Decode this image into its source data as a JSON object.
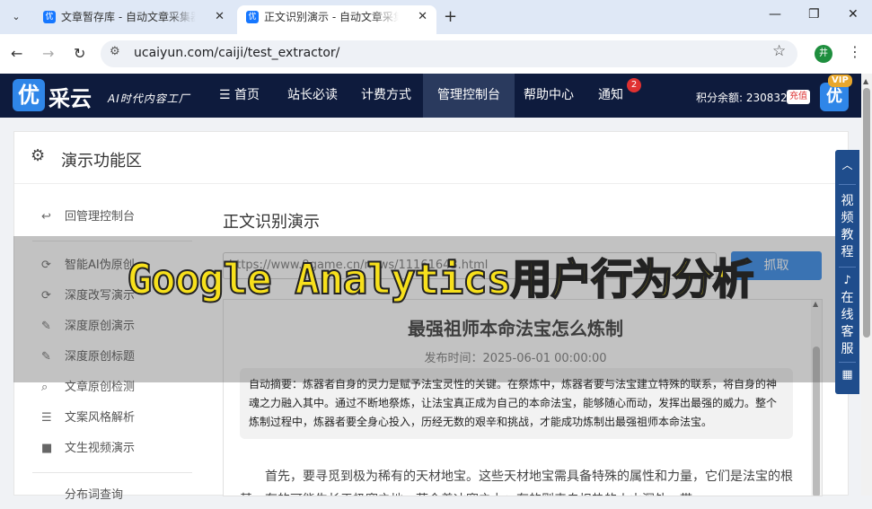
{
  "browser": {
    "tabs": [
      {
        "title": "文章暂存库 - 自动文章采集器 - 优采云",
        "active": false
      },
      {
        "title": "正文识别演示 - 自动文章采集器 - 优采云",
        "active": true
      }
    ],
    "new_tab": "+",
    "url": "ucaiyun.com/caiji/test_extractor/",
    "profile_initial": "井"
  },
  "site": {
    "logo_char": "优",
    "logo_text": "采云",
    "slogan": "AI时代内容工厂",
    "nav": [
      "☰ 首页",
      "站长必读",
      "计费方式",
      "管理控制台",
      "帮助中心",
      "通知"
    ],
    "notify_count": "2",
    "points_text": "积分余额: 2308329",
    "recharge": "充值",
    "vip": "VIP",
    "avatar_char": "优"
  },
  "panel": {
    "title": "演示功能区",
    "sidebar": [
      {
        "icon": "↩",
        "label": "回管理控制台"
      },
      {
        "icon": "⟳",
        "label": "智能AI伪原创"
      },
      {
        "icon": "⟳",
        "label": "深度改写演示"
      },
      {
        "icon": "✎",
        "label": "深度原创演示"
      },
      {
        "icon": "✎",
        "label": "深度原创标题"
      },
      {
        "icon": "⌕",
        "label": "文章原创检测"
      },
      {
        "icon": "☰",
        "label": "文案风格解析"
      },
      {
        "icon": "■",
        "label": "文生视频演示"
      },
      {
        "icon": "",
        "label": "分布词查询"
      }
    ]
  },
  "demo": {
    "title": "正文识别演示",
    "url_value": "https://www.9game.cn/news/11161643.html",
    "grab_button": "抓取",
    "article_title": "最强祖师本命法宝怎么炼制",
    "article_time": "发布时间：2025-06-01 00:00:00",
    "summary": "自动摘要：炼器者自身的灵力是赋予法宝灵性的关键。在祭炼中，炼器者要与法宝建立特殊的联系，将自身的神魂之力融入其中。通过不断地祭炼，让法宝真正成为自己的本命法宝，能够随心而动，发挥出最强的威力。整个炼制过程中，炼器者要全身心投入，历经无数的艰辛和挑战，才能成功炼制出最强祖师本命法宝。",
    "body": "首先，要寻觅到极为稀有的天材地宝。这些天材地宝需具备特殊的属性和力量，它们是法宝的根基。有的可能生长于极寒之地，蕴含着冰寒之力；有的则来自炽热的火山深处，带"
  },
  "overlay_caption": "Google Analytics用户行为分析",
  "float_panel": {
    "video_label": "视频教程",
    "service_label": "在线客服"
  }
}
